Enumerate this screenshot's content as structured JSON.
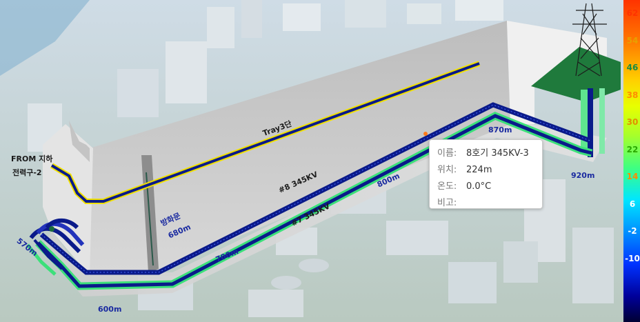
{
  "labels": {
    "from": "FROM 지하",
    "source": "전력구-2",
    "tray": "Tray3단",
    "cable8": "#8 345KV",
    "cable7": "#7 345KV",
    "fire_door": "방화문",
    "fire_door_dist": "680m",
    "d570": "570m",
    "d600": "600m",
    "d700": "700m",
    "d800": "800m",
    "d870": "870m",
    "d920": "920m"
  },
  "tooltip": {
    "name_key": "이름:",
    "name_val": "8호기 345KV-3",
    "pos_key": "위치:",
    "pos_val": "224m",
    "temp_key": "온도:",
    "temp_val": "0.0°C",
    "note_key": "비고:",
    "note_val": ""
  },
  "legend": {
    "ticks": [
      "62",
      "54",
      "46",
      "38",
      "30",
      "22",
      "14",
      "6",
      "-2",
      "-10"
    ],
    "tick_colors": [
      "#ff3300",
      "#e8a000",
      "#1a8a40",
      "#ff8c00",
      "#e09000",
      "#2aa800",
      "#ff8c00",
      "#ffffff",
      "#ffffff",
      "#ffffff"
    ]
  },
  "colors": {
    "cable_dark": "#0a1a8a",
    "cable_green": "#3ce07a",
    "tray": "#f0e000",
    "wall": "#c9c9c9",
    "pad": "#1f7a3c"
  }
}
